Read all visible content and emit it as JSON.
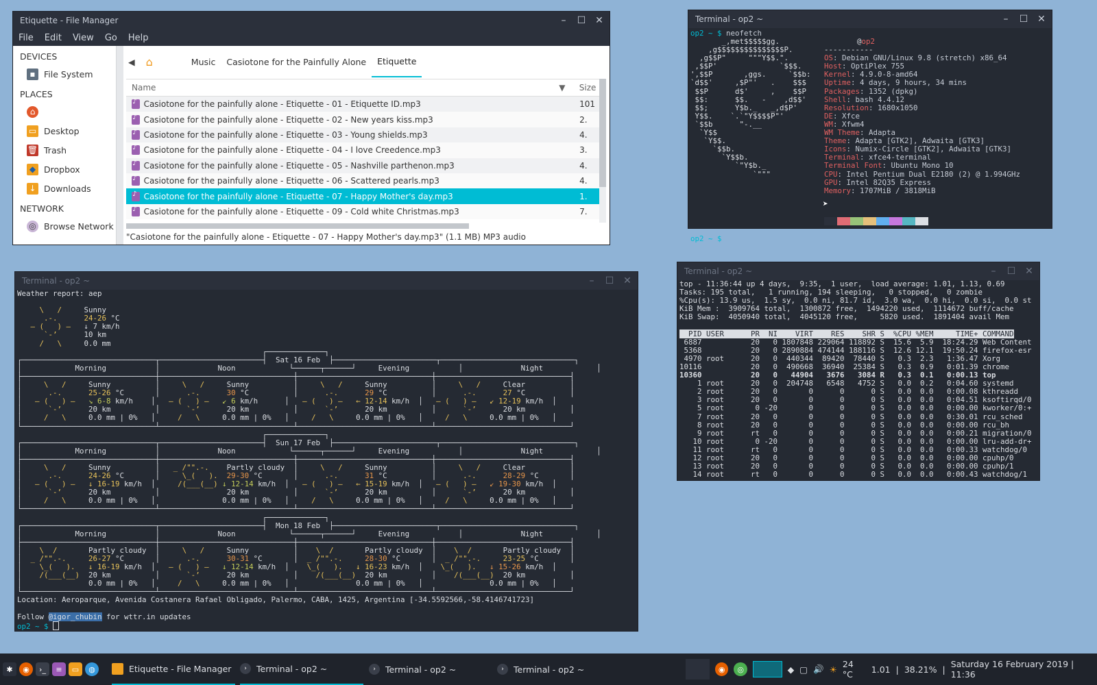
{
  "fm": {
    "title": "Etiquette - File Manager",
    "menu": [
      "File",
      "Edit",
      "View",
      "Go",
      "Help"
    ],
    "sidebar": {
      "devices_label": "DEVICES",
      "file_system": "File System",
      "places_label": "PLACES",
      "desktop": "Desktop",
      "trash": "Trash",
      "dropbox": "Dropbox",
      "downloads": "Downloads",
      "network_label": "NETWORK",
      "browse_network": "Browse Network"
    },
    "breadcrumb": [
      "Music",
      "Casiotone for the Painfully Alone",
      "Etiquette"
    ],
    "columns": {
      "name": "Name",
      "size": "Size"
    },
    "files": [
      {
        "name": "Casiotone for the painfully alone - Etiquette - 01 - Etiquette ID.mp3",
        "size": "101"
      },
      {
        "name": "Casiotone for the painfully alone - Etiquette - 02 - New years kiss.mp3",
        "size": "2."
      },
      {
        "name": "Casiotone for the painfully alone - Etiquette - 03 - Young shields.mp3",
        "size": "4."
      },
      {
        "name": "Casiotone for the painfully alone - Etiquette - 04 - I love Creedence.mp3",
        "size": "3."
      },
      {
        "name": "Casiotone for the painfully alone - Etiquette - 05 - Nashville parthenon.mp3",
        "size": "4."
      },
      {
        "name": "Casiotone for the painfully alone - Etiquette - 06 - Scattered pearls.mp3",
        "size": "4."
      },
      {
        "name": "Casiotone for the painfully alone - Etiquette - 07 - Happy Mother's day.mp3",
        "size": "1."
      },
      {
        "name": "Casiotone for the painfully alone - Etiquette - 09 - Cold white Christmas.mp3",
        "size": "7."
      }
    ],
    "status": "\"Casiotone for the painfully alone - Etiquette - 07 - Happy Mother's day.mp3\" (1.1 MB) MP3 audio"
  },
  "neofetch": {
    "title": "Terminal - op2 ~",
    "prompt_line": "op2 ~ $ neofetch",
    "user": "@op2",
    "rows": [
      {
        "key": "OS",
        "value": ": Debian GNU/Linux 9.8 (stretch) x86_64"
      },
      {
        "key": "Host",
        "value": ": OptiPlex 755"
      },
      {
        "key": "Kernel",
        "value": ": 4.9.0-8-amd64"
      },
      {
        "key": "Uptime",
        "value": ": 4 days, 9 hours, 34 mins"
      },
      {
        "key": "Packages",
        "value": ": 1352 (dpkg)"
      },
      {
        "key": "Shell",
        "value": ": bash 4.4.12"
      },
      {
        "key": "Resolution",
        "value": ": 1680x1050"
      },
      {
        "key": "DE",
        "value": ": Xfce"
      },
      {
        "key": "WM",
        "value": ": Xfwm4"
      },
      {
        "key": "WM Theme",
        "value": ": Adapta"
      },
      {
        "key": "Theme",
        "value": ": Adapta [GTK2], Adwaita [GTK3]"
      },
      {
        "key": "Icons",
        "value": ": Numix-Circle [GTK2], Adwaita [GTK3]"
      },
      {
        "key": "Terminal",
        "value": ": xfce4-terminal"
      },
      {
        "key": "Terminal Font",
        "value": ": Ubuntu Mono 10"
      },
      {
        "key": "CPU",
        "value": ": Intel Pentium Dual E2180 (2) @ 1.994GHz"
      },
      {
        "key": "GPU",
        "value": ": Intel 82Q35 Express"
      },
      {
        "key": "Memory",
        "value": ": 1707MiB / 3818MiB"
      }
    ],
    "swatches": [
      "#2b303b",
      "#e06c75",
      "#98c379",
      "#e5c07b",
      "#61afef",
      "#c678dd",
      "#56b6c2",
      "#dcdfe4"
    ],
    "prompt_end": "op2 ~ $"
  },
  "weather": {
    "title": "Terminal - op2 ~",
    "report": "Weather report: aep",
    "current": {
      "cond": "Sunny",
      "temp": "24-26",
      "unit": "°C",
      "wind": "↓ 7 km/h",
      "vis": "10 km",
      "precip": "0.0 mm"
    },
    "periods": [
      "Morning",
      "Noon",
      "Evening",
      "Night"
    ],
    "days": [
      {
        "label": "Sat 16 Feb",
        "cells": [
          {
            "cond": "Sunny",
            "temp": "25-26",
            "wind": "↘ 6-8",
            "vis": "20 km",
            "precip": "0.0 mm | 0%"
          },
          {
            "cond": "Sunny",
            "temp": "30",
            "wind": "↙ 6",
            "vis": "20 km",
            "precip": "0.0 mm | 0%"
          },
          {
            "cond": "Sunny",
            "temp": "29",
            "wind": "← 12-14",
            "vis": "20 km",
            "precip": "0.0 mm | 0%"
          },
          {
            "cond": "Clear",
            "temp": "27",
            "wind": "↙ 12-19",
            "vis": "20 km",
            "precip": "0.0 mm | 0%"
          }
        ]
      },
      {
        "label": "Sun 17 Feb",
        "cells": [
          {
            "cond": "Sunny",
            "temp": "24-26",
            "wind": "↓ 16-19",
            "vis": "20 km",
            "precip": "0.0 mm | 0%"
          },
          {
            "cond": "Partly cloudy",
            "temp": "29-30",
            "wind": "↓ 12-14",
            "vis": "20 km",
            "precip": "0.0 mm | 0%"
          },
          {
            "cond": "Sunny",
            "temp": "31",
            "wind": "← 15-19",
            "vis": "20 km",
            "precip": "0.0 mm | 0%"
          },
          {
            "cond": "Clear",
            "temp": "28-29",
            "wind": "↙ 19-30",
            "vis": "20 km",
            "precip": "0.0 mm | 0%"
          }
        ]
      },
      {
        "label": "Mon 18 Feb",
        "cells": [
          {
            "cond": "Partly cloudy",
            "temp": "26-27",
            "wind": "↓ 16-19",
            "vis": "20 km",
            "precip": "0.0 mm | 0%"
          },
          {
            "cond": "Sunny",
            "temp": "30-31",
            "wind": "↓ 12-14",
            "vis": "20 km",
            "precip": "0.0 mm | 0%"
          },
          {
            "cond": "Partly cloudy",
            "temp": "28-30",
            "wind": "↓ 16-23",
            "vis": "20 km",
            "precip": "0.0 mm | 0%"
          },
          {
            "cond": "Partly cloudy",
            "temp": "23-25",
            "wind": "↓ 15-26",
            "vis": "20 km",
            "precip": "0.0 mm | 0%"
          }
        ]
      }
    ],
    "location": "Location: Aeroparque, Avenida Costanera Rafael Obligado, Palermo, CABA, 1425, Argentina [-34.5592566,-58.4146741723]",
    "follow_pre": "Follow ",
    "follow_handle": "@igor_chubin",
    "follow_post": " for wttr.in updates",
    "prompt": "op2 ~ $"
  },
  "top": {
    "title": "Terminal - op2 ~",
    "summary": [
      "top - 11:36:44 up 4 days,  9:35,  1 user,  load average: 1.01, 1.13, 0.69",
      "Tasks: 195 total,   1 running, 194 sleeping,   0 stopped,   0 zombie",
      "%Cpu(s): 13.9 us,  1.5 sy,  0.0 ni, 81.7 id,  3.0 wa,  0.0 hi,  0.0 si,  0.0 st",
      "KiB Mem :  3909764 total,  1300872 free,  1494220 used,  1114672 buff/cache",
      "KiB Swap:  4050940 total,  4045120 free,     5820 used.  1891404 avail Mem"
    ],
    "header": "  PID USER      PR  NI    VIRT    RES    SHR S  %CPU %MEM     TIME+ COMMAND",
    "procs": [
      " 6887           20   0 1807848 229064 118892 S  15.6  5.9  18:24.29 Web Content",
      " 5368           20   0 2890884 474144 188116 S  12.6 12.1  19:50.24 firefox-esr",
      " 4970 root      20   0  440344  89420  78440 S   0.3  2.3   1:36.47 Xorg",
      "10116           20   0  490668  36940  25384 S   0.3  0.9   0:01.39 chrome",
      "10360           20   0   44904   3676   3084 R   0.3  0.1   0:00.13 top",
      "    1 root      20   0  204748   6548   4752 S   0.0  0.2   0:04.60 systemd",
      "    2 root      20   0       0      0      0 S   0.0  0.0   0:00.08 kthreadd",
      "    3 root      20   0       0      0      0 S   0.0  0.0   0:04.51 ksoftirqd/0",
      "    5 root       0 -20       0      0      0 S   0.0  0.0   0:00.00 kworker/0:+",
      "    7 root      20   0       0      0      0 S   0.0  0.0   0:30.01 rcu_sched",
      "    8 root      20   0       0      0      0 S   0.0  0.0   0:00.00 rcu_bh",
      "    9 root      rt   0       0      0      0 S   0.0  0.0   0:00.21 migration/0",
      "   10 root       0 -20       0      0      0 S   0.0  0.0   0:00.00 lru-add-dr+",
      "   11 root      rt   0       0      0      0 S   0.0  0.0   0:00.33 watchdog/0",
      "   12 root      20   0       0      0      0 S   0.0  0.0   0:00.00 cpuhp/0",
      "   13 root      20   0       0      0      0 S   0.0  0.0   0:00.00 cpuhp/1",
      "   14 root      rt   0       0      0      0 S   0.0  0.0   0:00.43 watchdog/1"
    ]
  },
  "taskbar": {
    "tasks": [
      {
        "label": "Etiquette - File Manager"
      },
      {
        "label": "Terminal - op2 ~"
      },
      {
        "label": "Terminal - op2 ~"
      },
      {
        "label": "Terminal - op2 ~"
      }
    ],
    "weather": "24 °C",
    "load": "1.01",
    "mem": "38.21%",
    "clock": "Saturday 16 February 2019 | 11:36"
  }
}
